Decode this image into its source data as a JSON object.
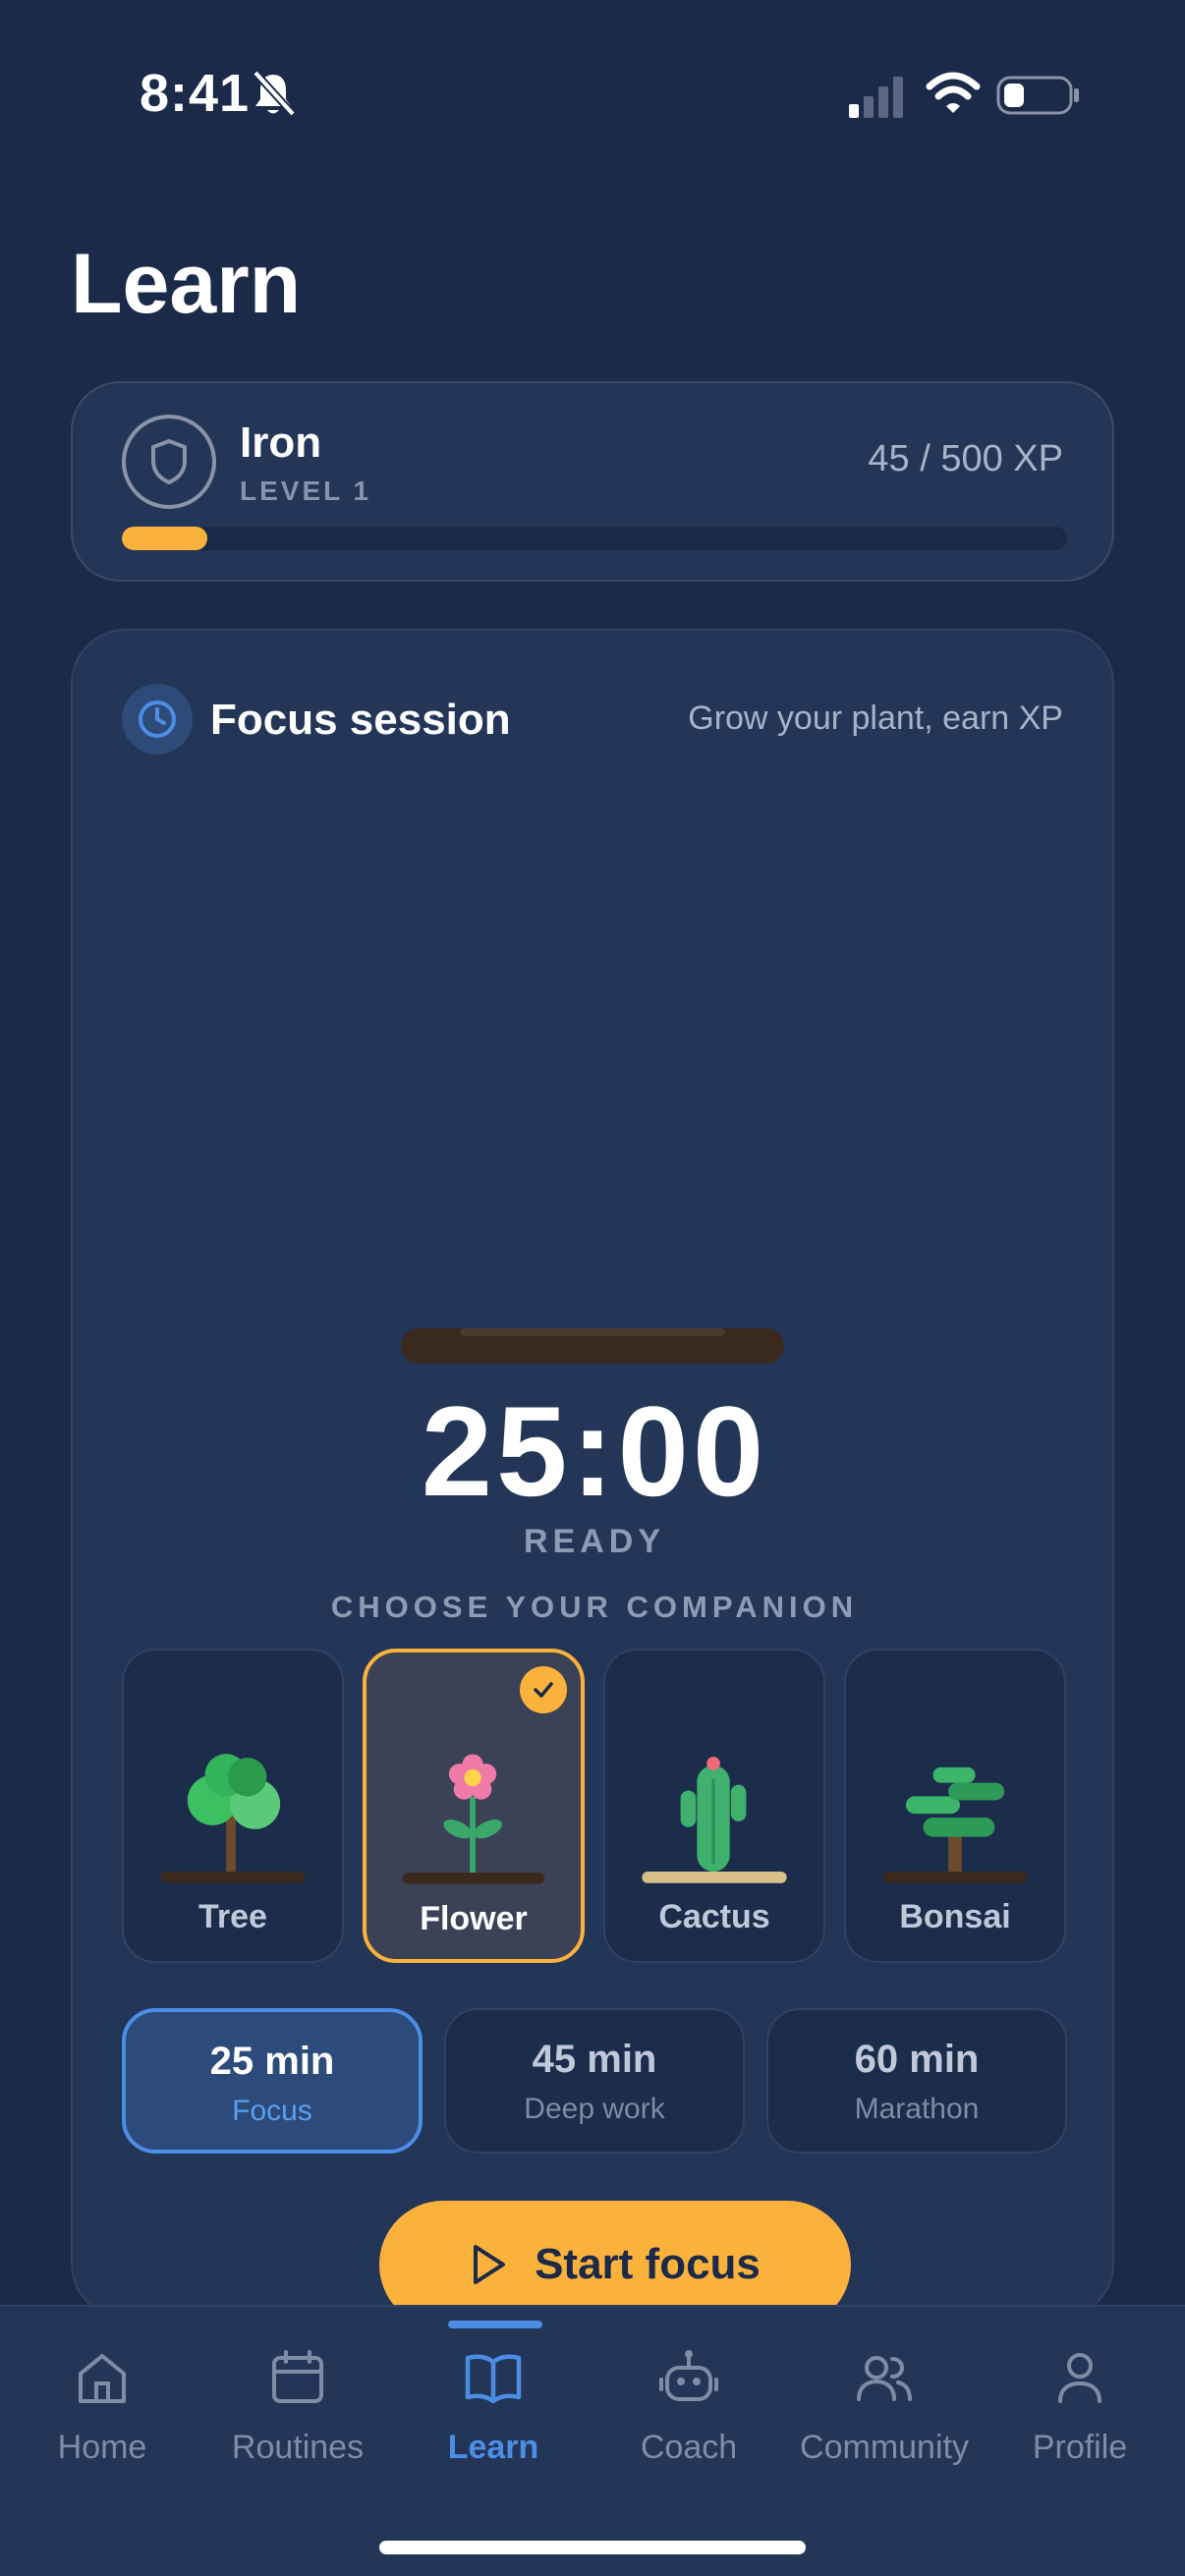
{
  "status_bar": {
    "time": "8:41"
  },
  "page_title": "Learn",
  "level": {
    "name": "Iron",
    "level_label": "LEVEL 1",
    "xp_text": "45 / 500 XP",
    "xp_progress": 0.09,
    "accent": "#fbb23d"
  },
  "focus": {
    "title": "Focus session",
    "subtitle": "Grow your plant, earn XP",
    "timer": "25:00",
    "state": "READY",
    "choose_label": "CHOOSE YOUR COMPANION",
    "companions": [
      {
        "label": "Tree",
        "selected": false
      },
      {
        "label": "Flower",
        "selected": true
      },
      {
        "label": "Cactus",
        "selected": false
      },
      {
        "label": "Bonsai",
        "selected": false
      }
    ],
    "durations": [
      {
        "time": "25 min",
        "mode": "Focus",
        "active": true
      },
      {
        "time": "45 min",
        "mode": "Deep work",
        "active": false
      },
      {
        "time": "60 min",
        "mode": "Marathon",
        "active": false
      }
    ],
    "start_label": "Start focus"
  },
  "tabs": [
    {
      "label": "Home",
      "icon": "home-icon"
    },
    {
      "label": "Routines",
      "icon": "calendar-icon"
    },
    {
      "label": "Learn",
      "icon": "book-icon",
      "active": true
    },
    {
      "label": "Coach",
      "icon": "robot-icon"
    },
    {
      "label": "Community",
      "icon": "users-icon"
    },
    {
      "label": "Profile",
      "icon": "user-icon"
    }
  ]
}
